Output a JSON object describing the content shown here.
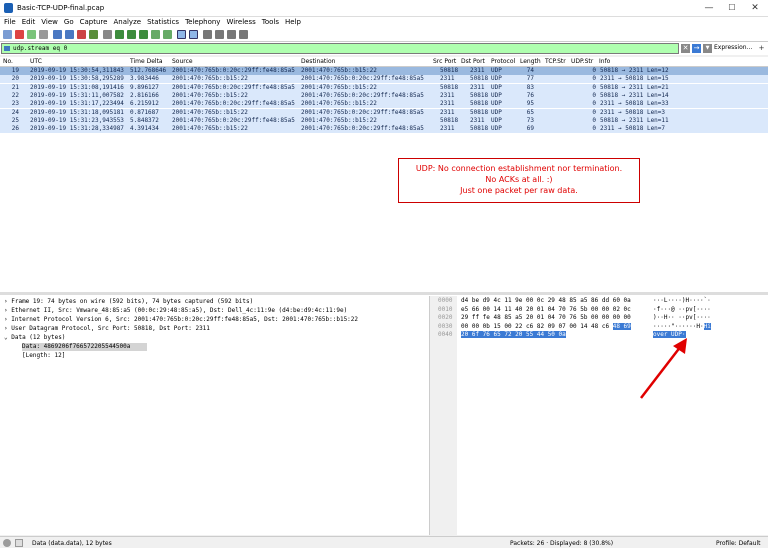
{
  "window": {
    "title": "Basic-TCP-UDP-final.pcap",
    "min": "—",
    "max": "☐",
    "close": "✕"
  },
  "menu": [
    "File",
    "Edit",
    "View",
    "Go",
    "Capture",
    "Analyze",
    "Statistics",
    "Telephony",
    "Wireless",
    "Tools",
    "Help"
  ],
  "filter": {
    "value": "udp.stream eq 0",
    "clear": "✕",
    "apply": "→",
    "expression_label": "Expression…"
  },
  "columns": [
    "No.",
    "UTC",
    "Time Delta",
    "Source",
    "Destination",
    "Src Port",
    "Dst Port",
    "Protocol",
    "Length",
    "TCP.Str",
    "UDP.Str",
    "Info"
  ],
  "packets": [
    {
      "no": "19",
      "utc": "2019-09-19 15:30:54,311843",
      "delta": "512.768646",
      "src": "2001:470:765b:0:20c:29ff:fe48:85a5",
      "dst": "2001:470:765b::b15:22",
      "sport": "50818",
      "dport": "2311",
      "proto": "UDP",
      "len": "74",
      "udpstr": "0",
      "info": "50818 → 2311 Len=12",
      "selected": true
    },
    {
      "no": "20",
      "utc": "2019-09-19 15:30:58,295289",
      "delta": "3.983446",
      "src": "2001:470:765b::b15:22",
      "dst": "2001:470:765b:0:20c:29ff:fe48:85a5",
      "sport": "2311",
      "dport": "50818",
      "proto": "UDP",
      "len": "77",
      "udpstr": "0",
      "info": "2311 → 50818 Len=15",
      "selected": false
    },
    {
      "no": "21",
      "utc": "2019-09-19 15:31:08,191416",
      "delta": "9.896127",
      "src": "2001:470:765b:0:20c:29ff:fe48:85a5",
      "dst": "2001:470:765b::b15:22",
      "sport": "50818",
      "dport": "2311",
      "proto": "UDP",
      "len": "83",
      "udpstr": "0",
      "info": "50818 → 2311 Len=21",
      "selected": false
    },
    {
      "no": "22",
      "utc": "2019-09-19 15:31:11,007582",
      "delta": "2.816166",
      "src": "2001:470:765b::b15:22",
      "dst": "2001:470:765b:0:20c:29ff:fe48:85a5",
      "sport": "2311",
      "dport": "50818",
      "proto": "UDP",
      "len": "76",
      "udpstr": "0",
      "info": "50818 → 2311 Len=14",
      "selected": false
    },
    {
      "no": "23",
      "utc": "2019-09-19 15:31:17,223494",
      "delta": "6.215912",
      "src": "2001:470:765b:0:20c:29ff:fe48:85a5",
      "dst": "2001:470:765b::b15:22",
      "sport": "2311",
      "dport": "50818",
      "proto": "UDP",
      "len": "95",
      "udpstr": "0",
      "info": "2311 → 50818 Len=33",
      "selected": false
    },
    {
      "no": "24",
      "utc": "2019-09-19 15:31:18,095181",
      "delta": "0.871687",
      "src": "2001:470:765b::b15:22",
      "dst": "2001:470:765b:0:20c:29ff:fe48:85a5",
      "sport": "2311",
      "dport": "50818",
      "proto": "UDP",
      "len": "65",
      "udpstr": "0",
      "info": "2311 → 50818 Len=3",
      "selected": false
    },
    {
      "no": "25",
      "utc": "2019-09-19 15:31:23,943553",
      "delta": "5.848372",
      "src": "2001:470:765b:0:20c:29ff:fe48:85a5",
      "dst": "2001:470:765b::b15:22",
      "sport": "50818",
      "dport": "2311",
      "proto": "UDP",
      "len": "73",
      "udpstr": "0",
      "info": "50818 → 2311 Len=11",
      "selected": false
    },
    {
      "no": "26",
      "utc": "2019-09-19 15:31:28,334987",
      "delta": "4.391434",
      "src": "2001:470:765b::b15:22",
      "dst": "2001:470:765b:0:20c:29ff:fe48:85a5",
      "sport": "2311",
      "dport": "50818",
      "proto": "UDP",
      "len": "69",
      "udpstr": "0",
      "info": "2311 → 50818 Len=7",
      "selected": false
    }
  ],
  "annotation": {
    "line1": "UDP: No connection establishment nor termination.",
    "line2": "No ACKs at all. :)",
    "line3": "Just one packet per raw data."
  },
  "tree": {
    "frame": "Frame 19: 74 bytes on wire (592 bits), 74 bytes captured (592 bits)",
    "eth": "Ethernet II, Src: Vmware_48:85:a5 (00:0c:29:48:85:a5), Dst: Dell_4c:11:9e (d4:be:d9:4c:11:9e)",
    "ipv6": "Internet Protocol Version 6, Src: 2001:470:765b:0:20c:29ff:fe48:85a5, Dst: 2001:470:765b::b15:22",
    "udp": "User Datagram Protocol, Src Port: 50818, Dst Port: 2311",
    "data": "Data (12 bytes)",
    "data_value": "Data: 4869206f766572205544500a",
    "length": "[Length: 12]"
  },
  "hex": {
    "offsets": [
      "0000",
      "0010",
      "0020",
      "0030",
      "0040"
    ],
    "rows": [
      {
        "pre": "d4 be d9 4c 11 9e 00 0c  29 48 85 a5 86 dd 60 0a",
        "hl": "",
        "ascii_pre": "···L····)H····`·",
        "ascii_hl": ""
      },
      {
        "pre": "e5 66 00 14 11 40 20 01  04 70 76 5b 00 00 02 0c",
        "hl": "",
        "ascii_pre": "·f···@ ··pv[····",
        "ascii_hl": ""
      },
      {
        "pre": "29 ff fe 48 85 a5 20 01  04 70 76 5b 00 00 00 00",
        "hl": "",
        "ascii_pre": ")··H·· ··pv[····",
        "ascii_hl": ""
      },
      {
        "pre": "00 00 0b 15 00 22 c6 82  09 07 00 14 48 c6 ",
        "hl": "48 69",
        "ascii_pre": "·····\"······H·",
        "ascii_hl": "Hi"
      },
      {
        "pre": "",
        "hl": "20 6f 76 65 72 20 55 44  50 0a",
        "ascii_pre": "",
        "ascii_hl": " over UDP·"
      }
    ]
  },
  "status": {
    "left": "Data (data.data), 12 bytes",
    "packets": "Packets: 26 · Displayed: 8 (30.8%)",
    "profile": "Profile: Default"
  },
  "colors": {
    "filter_ok": "#afffaf",
    "udp_row": "#dae8fb",
    "selected_row": "#9ab9df",
    "annotation": "#e00000"
  }
}
